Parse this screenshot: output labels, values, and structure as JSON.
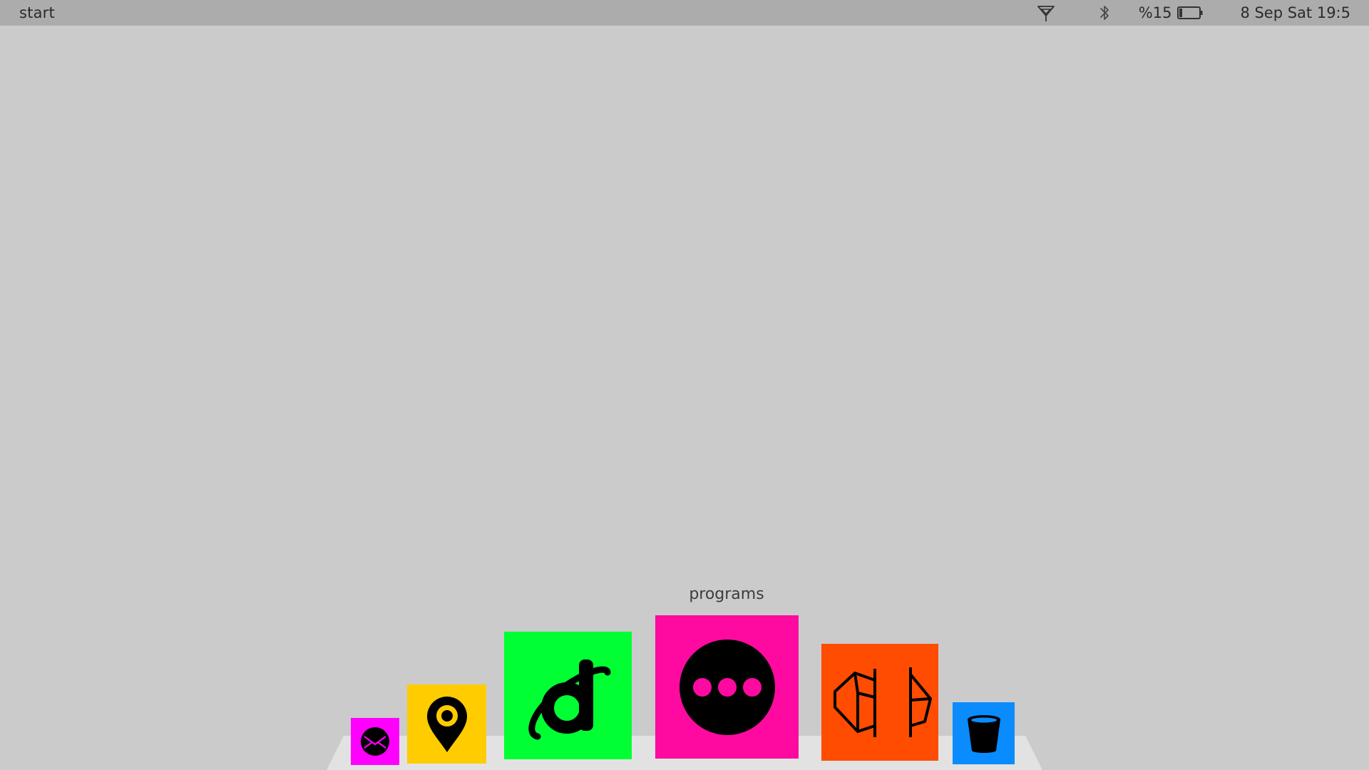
{
  "menubar": {
    "start_label": "start",
    "wifi_icon": "wifi-icon",
    "bluetooth_icon": "bluetooth-icon",
    "battery_text": "%15",
    "battery_icon": "battery-icon",
    "battery_level": 0.15,
    "clock_text": "8 Sep Sat 19:5"
  },
  "dock": {
    "hover_label": "programs",
    "items": [
      {
        "icon": "mail-icon",
        "color": "#ff00ff"
      },
      {
        "icon": "map-pin-icon",
        "color": "#ffcc00"
      },
      {
        "icon": "browser-icon",
        "color": "#00ff33"
      },
      {
        "icon": "more-icon",
        "color": "#ff0aa0"
      },
      {
        "icon": "3d-sketch-icon",
        "color": "#ff4c00"
      },
      {
        "icon": "trash-icon",
        "color": "#0a8cff"
      }
    ]
  },
  "colors": {
    "desktop_background": "#cbcbcb",
    "menubar_background": "#acacac",
    "dock_shelf": "#e2e2e2"
  }
}
